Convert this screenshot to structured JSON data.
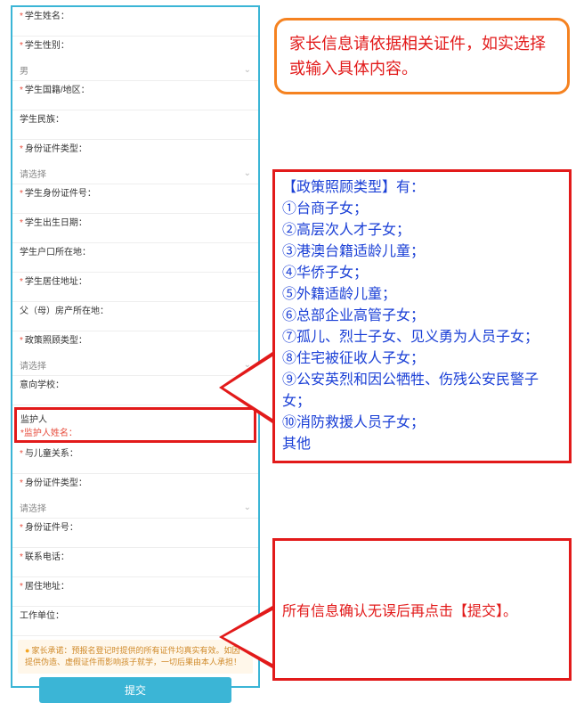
{
  "form": {
    "student_name_label": "学生姓名：",
    "student_gender_label": "学生性别：",
    "student_gender_value": "男",
    "student_nationality_label": "学生国籍/地区：",
    "student_ethnicity_label": "学生民族：",
    "id_type_label": "身份证件类型：",
    "id_type_placeholder": "请选择",
    "student_id_number_label": "学生身份证件号：",
    "student_birthdate_label": "学生出生日期：",
    "student_hukou_label": "学生户口所在地：",
    "student_address_label": "学生居住地址：",
    "parent_property_label": "父（母）房产所在地：",
    "policy_type_label": "政策照顾类型：",
    "policy_type_placeholder": "请选择",
    "intended_school_label": "意向学校：",
    "guardian_section": "监护人",
    "guardian_name_label": "*监护人姓名：",
    "relation_label": "与儿童关系：",
    "guardian_id_type_label": "身份证件类型：",
    "guardian_id_type_placeholder": "请选择",
    "guardian_id_number_label": "身份证件号：",
    "phone_label": "联系电话：",
    "guardian_address_label": "居住地址：",
    "work_unit_label": "工作单位：",
    "disclaimer": "家长承诺：预报名登记时提供的所有证件均真实有效。如因提供伪造、虚假证件而影响孩子就学，一切后果由本人承担！",
    "submit_label": "提交"
  },
  "callouts": {
    "orange_text": "家长信息请依据相关证件，如实选择或输入具体内容。",
    "policy_header": "【政策照顾类型】有：",
    "policy_items": [
      "①台商子女；",
      "②高层次人才子女；",
      "③港澳台籍适龄儿童；",
      "④华侨子女；",
      "⑤外籍适龄儿童；",
      "⑥总部企业高管子女；",
      "⑦孤儿、烈士子女、见义勇为人员子女；",
      "⑧住宅被征收人子女；",
      "⑨公安英烈和因公牺牲、伤残公安民警子女；",
      "⑩消防救援人员子女；",
      "其他"
    ],
    "submit_text": "所有信息确认无误后再点击【提交】。"
  }
}
